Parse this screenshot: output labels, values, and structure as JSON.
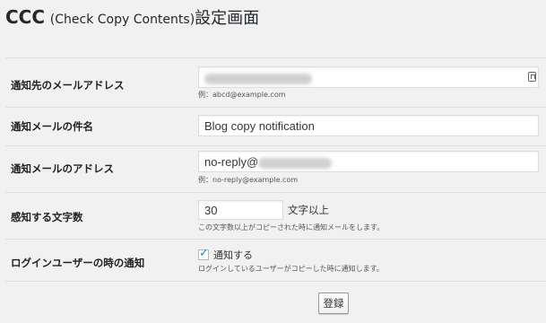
{
  "header": {
    "title_main": "CCC",
    "title_paren": "(Check Copy Contents)",
    "title_suffix": "設定画面"
  },
  "fields": {
    "notify_email": {
      "label": "通知先のメールアドレス",
      "hint": "例：abcd@example.com"
    },
    "subject": {
      "label": "通知メールの件名",
      "value": "Blog copy notification"
    },
    "from_address": {
      "label": "通知メールのアドレス",
      "value_prefix": "no-reply@",
      "hint": "例：no-reply@example.com"
    },
    "min_chars": {
      "label": "感知する文字数",
      "value": "30",
      "unit": "文字以上",
      "hint": "この文字数以上がコピーされた時に通知メールをします。"
    },
    "login_notify": {
      "label": "ログインユーザーの時の通知",
      "checked": true,
      "checkbox_label": "通知する",
      "hint": "ログインしているユーザーがコピーした時に通知します。"
    }
  },
  "actions": {
    "submit_label": "登録"
  },
  "colors": {
    "background": "#f1f1f1",
    "checkbox_mark": "#1e8cbe"
  }
}
